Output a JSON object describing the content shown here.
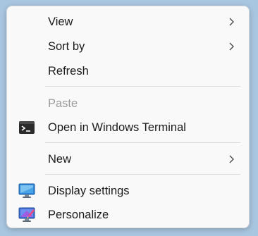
{
  "menu": {
    "items": [
      {
        "label": "View",
        "has_submenu": true,
        "enabled": true
      },
      {
        "label": "Sort by",
        "has_submenu": true,
        "enabled": true
      },
      {
        "label": "Refresh",
        "has_submenu": false,
        "enabled": true
      },
      {
        "label": "Paste",
        "has_submenu": false,
        "enabled": false
      },
      {
        "label": "Open in Windows Terminal",
        "has_submenu": false,
        "enabled": true,
        "icon": "terminal-icon"
      },
      {
        "label": "New",
        "has_submenu": true,
        "enabled": true
      },
      {
        "label": "Display settings",
        "has_submenu": false,
        "enabled": true,
        "icon": "display-settings-icon"
      },
      {
        "label": "Personalize",
        "has_submenu": false,
        "enabled": true,
        "icon": "personalize-icon"
      }
    ]
  },
  "colors": {
    "menu_background": "#f9f9f9",
    "desktop_background": "#a9c6e0",
    "text": "#1b1b1b",
    "disabled_text": "#9b9b9b",
    "separator": "#dcdcdc"
  }
}
